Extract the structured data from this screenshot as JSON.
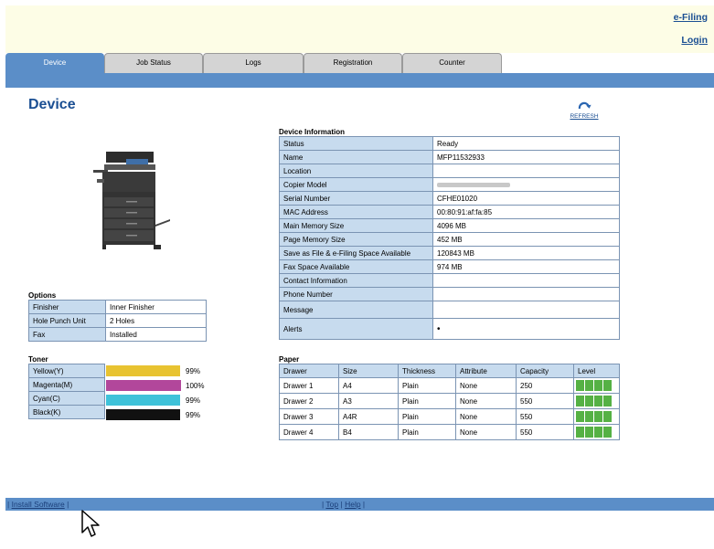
{
  "header": {
    "efiling_link": "e-Filing",
    "login_link": "Login"
  },
  "tabs": [
    {
      "label": "Device"
    },
    {
      "label": "Job Status"
    },
    {
      "label": "Logs"
    },
    {
      "label": "Registration"
    },
    {
      "label": "Counter"
    }
  ],
  "page_title": "Device",
  "refresh_label": "REFRESH",
  "device_info": {
    "title": "Device Information",
    "rows": [
      {
        "key": "Status",
        "value": "Ready"
      },
      {
        "key": "Name",
        "value": "MFP11532933"
      },
      {
        "key": "Location",
        "value": ""
      },
      {
        "key": "Copier Model",
        "value": ""
      },
      {
        "key": "Serial Number",
        "value": "CFHE01020"
      },
      {
        "key": "MAC Address",
        "value": "00:80:91:af:fa:85"
      },
      {
        "key": "Main Memory Size",
        "value": "4096 MB"
      },
      {
        "key": "Page Memory Size",
        "value": "452 MB"
      },
      {
        "key": "Save as File & e-Filing Space Available",
        "value": "120843 MB"
      },
      {
        "key": "Fax Space Available",
        "value": "974 MB"
      },
      {
        "key": "Contact Information",
        "value": ""
      },
      {
        "key": "Phone Number",
        "value": ""
      },
      {
        "key": "Message",
        "value": ""
      },
      {
        "key": "Alerts",
        "value": "•"
      }
    ]
  },
  "options": {
    "title": "Options",
    "rows": [
      {
        "key": "Finisher",
        "value": "Inner Finisher"
      },
      {
        "key": "Hole Punch Unit",
        "value": "2 Holes"
      },
      {
        "key": "Fax",
        "value": "Installed"
      }
    ]
  },
  "toner": {
    "title": "Toner",
    "rows": [
      {
        "name": "Yellow(Y)",
        "percent": "99%",
        "level": 0.99,
        "color": "#e8c331"
      },
      {
        "name": "Magenta(M)",
        "percent": "100%",
        "level": 1.0,
        "color": "#b2479b"
      },
      {
        "name": "Cyan(C)",
        "percent": "99%",
        "level": 0.99,
        "color": "#3fc2d9"
      },
      {
        "name": "Black(K)",
        "percent": "99%",
        "level": 0.99,
        "color": "#111111"
      }
    ]
  },
  "paper": {
    "title": "Paper",
    "headers": [
      "Drawer",
      "Size",
      "Thickness",
      "Attribute",
      "Capacity",
      "Level"
    ],
    "rows": [
      {
        "drawer": "Drawer 1",
        "size": "A4",
        "thickness": "Plain",
        "attribute": "None",
        "capacity": "250"
      },
      {
        "drawer": "Drawer 2",
        "size": "A3",
        "thickness": "Plain",
        "attribute": "None",
        "capacity": "550"
      },
      {
        "drawer": "Drawer 3",
        "size": "A4R",
        "thickness": "Plain",
        "attribute": "None",
        "capacity": "550"
      },
      {
        "drawer": "Drawer 4",
        "size": "B4",
        "thickness": "Plain",
        "attribute": "None",
        "capacity": "550"
      }
    ]
  },
  "footer": {
    "install_software": "Install Software",
    "top": "Top",
    "help": "Help"
  },
  "colors": {
    "accent": "#5b8ec8",
    "title": "#1b4f93",
    "key_cell": "#c7dbee",
    "header_bg": "#fdfde6",
    "level_green": "#55b144"
  }
}
